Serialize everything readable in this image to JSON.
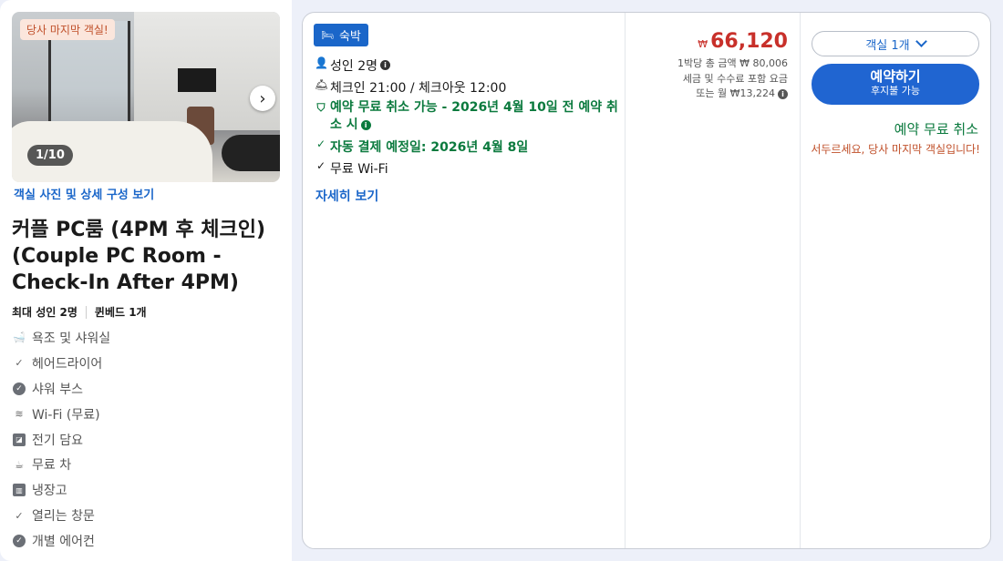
{
  "room": {
    "last_room_badge": "당사 마지막 객실!",
    "photo_counter": "1/10",
    "photo_link": "객실 사진 및 상세 구성 보기",
    "title": "커플 PC룸 (4PM 후 체크인) (Couple PC Room - Check-In After 4PM)",
    "max_guests": "최대 성인 2명",
    "bed": "퀸베드 1개",
    "amenities": [
      {
        "icon": "bathtub-icon",
        "label": "욕조 및 샤워실"
      },
      {
        "icon": "check-icon",
        "label": "헤어드라이어"
      },
      {
        "icon": "check-circle-icon",
        "label": "샤워 부스"
      },
      {
        "icon": "wifi-icon",
        "label": "Wi-Fi (무료)"
      },
      {
        "icon": "blanket-icon",
        "label": "전기 담요"
      },
      {
        "icon": "hot-drink-icon",
        "label": "무료 차"
      },
      {
        "icon": "fridge-icon",
        "label": "냉장고"
      },
      {
        "icon": "check-icon",
        "label": "열리는 창문"
      },
      {
        "icon": "check-circle-icon",
        "label": "개별 에어컨"
      }
    ]
  },
  "offer": {
    "stay_badge": "숙박",
    "guests": "성인 2명",
    "checkin": "체크인 21:00 / 체크아웃 12:00",
    "free_cancel_line1": "예약 무료 취소 가능 - 2026년 4월 10일 전 예약 취",
    "free_cancel_line2": "소 시",
    "auto_pay": "자동 결제 예정일: 2026년 4월 8일",
    "wifi": "무료 Wi-Fi",
    "more_link": "자세히 보기"
  },
  "pricing": {
    "currency": "₩",
    "amount": "66,120",
    "total_line": "1박당 총 금액 ₩ 80,006",
    "tax_line": "세금 및 수수료 포함 요금",
    "monthly_line": "또는 월 ₩13,224"
  },
  "booking": {
    "rooms_select": "객실 1개",
    "book_label": "예약하기",
    "book_sublabel": "후지불 가능",
    "free_cancel": "예약 무료 취소",
    "hurry_text": "서두르세요, 당사 마지막 객실입니다!"
  },
  "colors": {
    "accent_blue": "#1a66c9",
    "button_blue": "#2065d1",
    "price_red": "#c8302a",
    "green": "#0b7a3e",
    "warn_orange": "#c0502a"
  }
}
